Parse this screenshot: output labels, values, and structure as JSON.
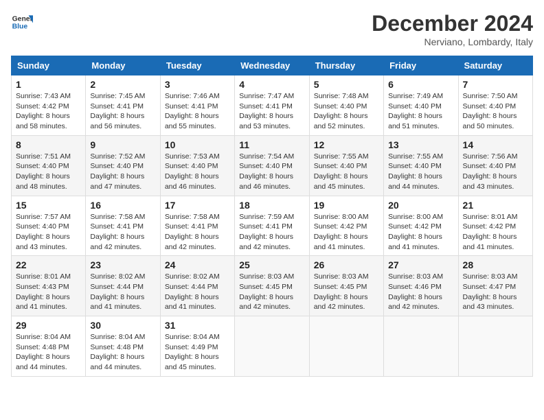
{
  "header": {
    "logo_line1": "General",
    "logo_line2": "Blue",
    "month": "December 2024",
    "location": "Nerviano, Lombardy, Italy"
  },
  "weekdays": [
    "Sunday",
    "Monday",
    "Tuesday",
    "Wednesday",
    "Thursday",
    "Friday",
    "Saturday"
  ],
  "weeks": [
    [
      {
        "day": "1",
        "sunrise": "7:43 AM",
        "sunset": "4:42 PM",
        "daylight": "8 hours and 58 minutes."
      },
      {
        "day": "2",
        "sunrise": "7:45 AM",
        "sunset": "4:41 PM",
        "daylight": "8 hours and 56 minutes."
      },
      {
        "day": "3",
        "sunrise": "7:46 AM",
        "sunset": "4:41 PM",
        "daylight": "8 hours and 55 minutes."
      },
      {
        "day": "4",
        "sunrise": "7:47 AM",
        "sunset": "4:41 PM",
        "daylight": "8 hours and 53 minutes."
      },
      {
        "day": "5",
        "sunrise": "7:48 AM",
        "sunset": "4:40 PM",
        "daylight": "8 hours and 52 minutes."
      },
      {
        "day": "6",
        "sunrise": "7:49 AM",
        "sunset": "4:40 PM",
        "daylight": "8 hours and 51 minutes."
      },
      {
        "day": "7",
        "sunrise": "7:50 AM",
        "sunset": "4:40 PM",
        "daylight": "8 hours and 50 minutes."
      }
    ],
    [
      {
        "day": "8",
        "sunrise": "7:51 AM",
        "sunset": "4:40 PM",
        "daylight": "8 hours and 48 minutes."
      },
      {
        "day": "9",
        "sunrise": "7:52 AM",
        "sunset": "4:40 PM",
        "daylight": "8 hours and 47 minutes."
      },
      {
        "day": "10",
        "sunrise": "7:53 AM",
        "sunset": "4:40 PM",
        "daylight": "8 hours and 46 minutes."
      },
      {
        "day": "11",
        "sunrise": "7:54 AM",
        "sunset": "4:40 PM",
        "daylight": "8 hours and 46 minutes."
      },
      {
        "day": "12",
        "sunrise": "7:55 AM",
        "sunset": "4:40 PM",
        "daylight": "8 hours and 45 minutes."
      },
      {
        "day": "13",
        "sunrise": "7:55 AM",
        "sunset": "4:40 PM",
        "daylight": "8 hours and 44 minutes."
      },
      {
        "day": "14",
        "sunrise": "7:56 AM",
        "sunset": "4:40 PM",
        "daylight": "8 hours and 43 minutes."
      }
    ],
    [
      {
        "day": "15",
        "sunrise": "7:57 AM",
        "sunset": "4:40 PM",
        "daylight": "8 hours and 43 minutes."
      },
      {
        "day": "16",
        "sunrise": "7:58 AM",
        "sunset": "4:41 PM",
        "daylight": "8 hours and 42 minutes."
      },
      {
        "day": "17",
        "sunrise": "7:58 AM",
        "sunset": "4:41 PM",
        "daylight": "8 hours and 42 minutes."
      },
      {
        "day": "18",
        "sunrise": "7:59 AM",
        "sunset": "4:41 PM",
        "daylight": "8 hours and 42 minutes."
      },
      {
        "day": "19",
        "sunrise": "8:00 AM",
        "sunset": "4:42 PM",
        "daylight": "8 hours and 41 minutes."
      },
      {
        "day": "20",
        "sunrise": "8:00 AM",
        "sunset": "4:42 PM",
        "daylight": "8 hours and 41 minutes."
      },
      {
        "day": "21",
        "sunrise": "8:01 AM",
        "sunset": "4:42 PM",
        "daylight": "8 hours and 41 minutes."
      }
    ],
    [
      {
        "day": "22",
        "sunrise": "8:01 AM",
        "sunset": "4:43 PM",
        "daylight": "8 hours and 41 minutes."
      },
      {
        "day": "23",
        "sunrise": "8:02 AM",
        "sunset": "4:44 PM",
        "daylight": "8 hours and 41 minutes."
      },
      {
        "day": "24",
        "sunrise": "8:02 AM",
        "sunset": "4:44 PM",
        "daylight": "8 hours and 41 minutes."
      },
      {
        "day": "25",
        "sunrise": "8:03 AM",
        "sunset": "4:45 PM",
        "daylight": "8 hours and 42 minutes."
      },
      {
        "day": "26",
        "sunrise": "8:03 AM",
        "sunset": "4:45 PM",
        "daylight": "8 hours and 42 minutes."
      },
      {
        "day": "27",
        "sunrise": "8:03 AM",
        "sunset": "4:46 PM",
        "daylight": "8 hours and 42 minutes."
      },
      {
        "day": "28",
        "sunrise": "8:03 AM",
        "sunset": "4:47 PM",
        "daylight": "8 hours and 43 minutes."
      }
    ],
    [
      {
        "day": "29",
        "sunrise": "8:04 AM",
        "sunset": "4:48 PM",
        "daylight": "8 hours and 44 minutes."
      },
      {
        "day": "30",
        "sunrise": "8:04 AM",
        "sunset": "4:48 PM",
        "daylight": "8 hours and 44 minutes."
      },
      {
        "day": "31",
        "sunrise": "8:04 AM",
        "sunset": "4:49 PM",
        "daylight": "8 hours and 45 minutes."
      },
      null,
      null,
      null,
      null
    ]
  ],
  "labels": {
    "sunrise": "Sunrise:",
    "sunset": "Sunset:",
    "daylight": "Daylight:"
  }
}
